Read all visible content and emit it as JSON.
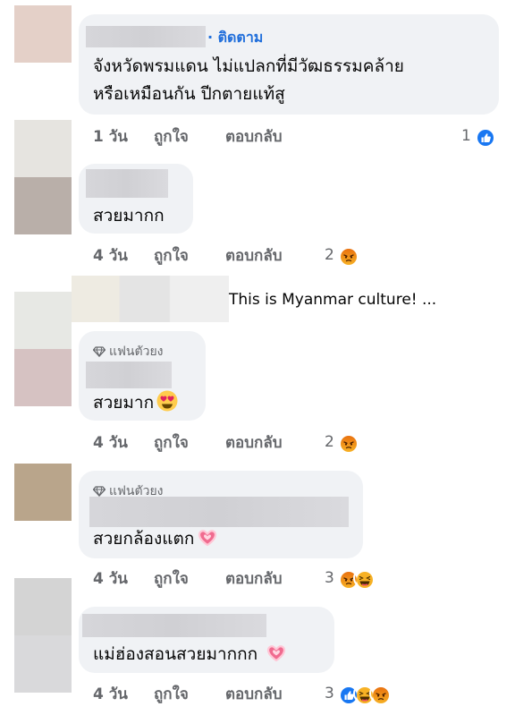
{
  "comments": [
    {
      "text_lines": [
        "จังหวัดพรมแดน ไม่แปลกที่มีวัฒธรรมคล้าย",
        "หรือเหมือนกัน ปีกตายแท้สู"
      ],
      "follow_label": "· ติดตาม",
      "time": "1 วัน",
      "like_label": "ถูกใจ",
      "reply_label": "ตอบกลับ",
      "reaction_count": "1",
      "reactions": [
        "like-icon"
      ]
    },
    {
      "text": "สวยมากก",
      "time": "4 วัน",
      "like_label": "ถูกใจ",
      "reply_label": "ตอบกลับ",
      "reaction_count": "2",
      "reactions": [
        "angry-icon"
      ]
    },
    {
      "text": "This is Myanmar culture!  ..."
    },
    {
      "badge": "แฟนตัวยง",
      "text": "สวยมาก",
      "text_emoji": "heart-eyes-icon",
      "time": "4 วัน",
      "like_label": "ถูกใจ",
      "reply_label": "ตอบกลับ",
      "reaction_count": "2",
      "reactions": [
        "angry-icon"
      ]
    },
    {
      "badge": "แฟนตัวยง",
      "text": "สวยกล้องแตก",
      "text_emoji": "sparkling-heart-icon",
      "time": "4 วัน",
      "like_label": "ถูกใจ",
      "reply_label": "ตอบกลับ",
      "reaction_count": "3",
      "reactions": [
        "angry-icon",
        "haha-icon"
      ]
    },
    {
      "text": "แม่ฮ่องสอนสวยมากกก ",
      "text_emoji": "sparkling-heart-icon",
      "time": "4 วัน",
      "like_label": "ถูกใจ",
      "reply_label": "ตอบกลับ",
      "reaction_count": "3",
      "reactions": [
        "like-icon",
        "haha-icon",
        "angry-icon"
      ]
    }
  ],
  "colors": {
    "bubble": "#f0f2f5",
    "secondary_text": "#65676b",
    "follow_link": "#216fdb",
    "like_blue": "#1877f2",
    "angry_orange": "#e9710f",
    "haha_yellow": "#f7b125"
  }
}
